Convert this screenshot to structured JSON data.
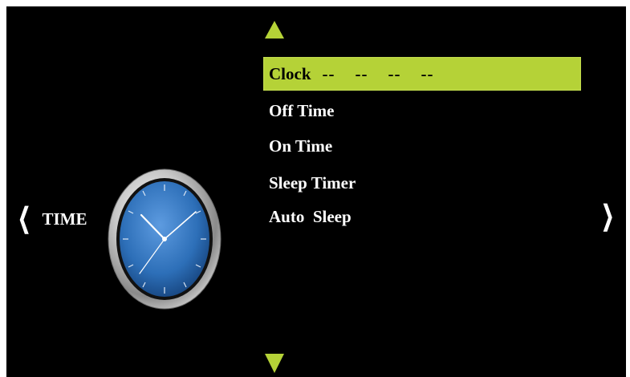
{
  "menu": {
    "items": [
      {
        "label": "Clock",
        "value": "--    --    --    --",
        "selected": true
      },
      {
        "label": "Off Time",
        "value": "",
        "selected": false
      },
      {
        "label": "On Time",
        "value": "",
        "selected": false
      },
      {
        "label": "Sleep Timer",
        "value": "",
        "selected": false
      },
      {
        "label": "Auto  Sleep",
        "value": "",
        "selected": false
      }
    ]
  },
  "category": {
    "label": "TIME",
    "prev_glyph": "❮",
    "next_glyph": "❯"
  },
  "colors": {
    "accent": "#b5d237",
    "background": "#000000",
    "text": "#ffffff",
    "clock_face": "#2d6fb8"
  },
  "icons": {
    "up": "triangle-up-icon",
    "down": "triangle-down-icon",
    "clock": "clock-icon"
  }
}
